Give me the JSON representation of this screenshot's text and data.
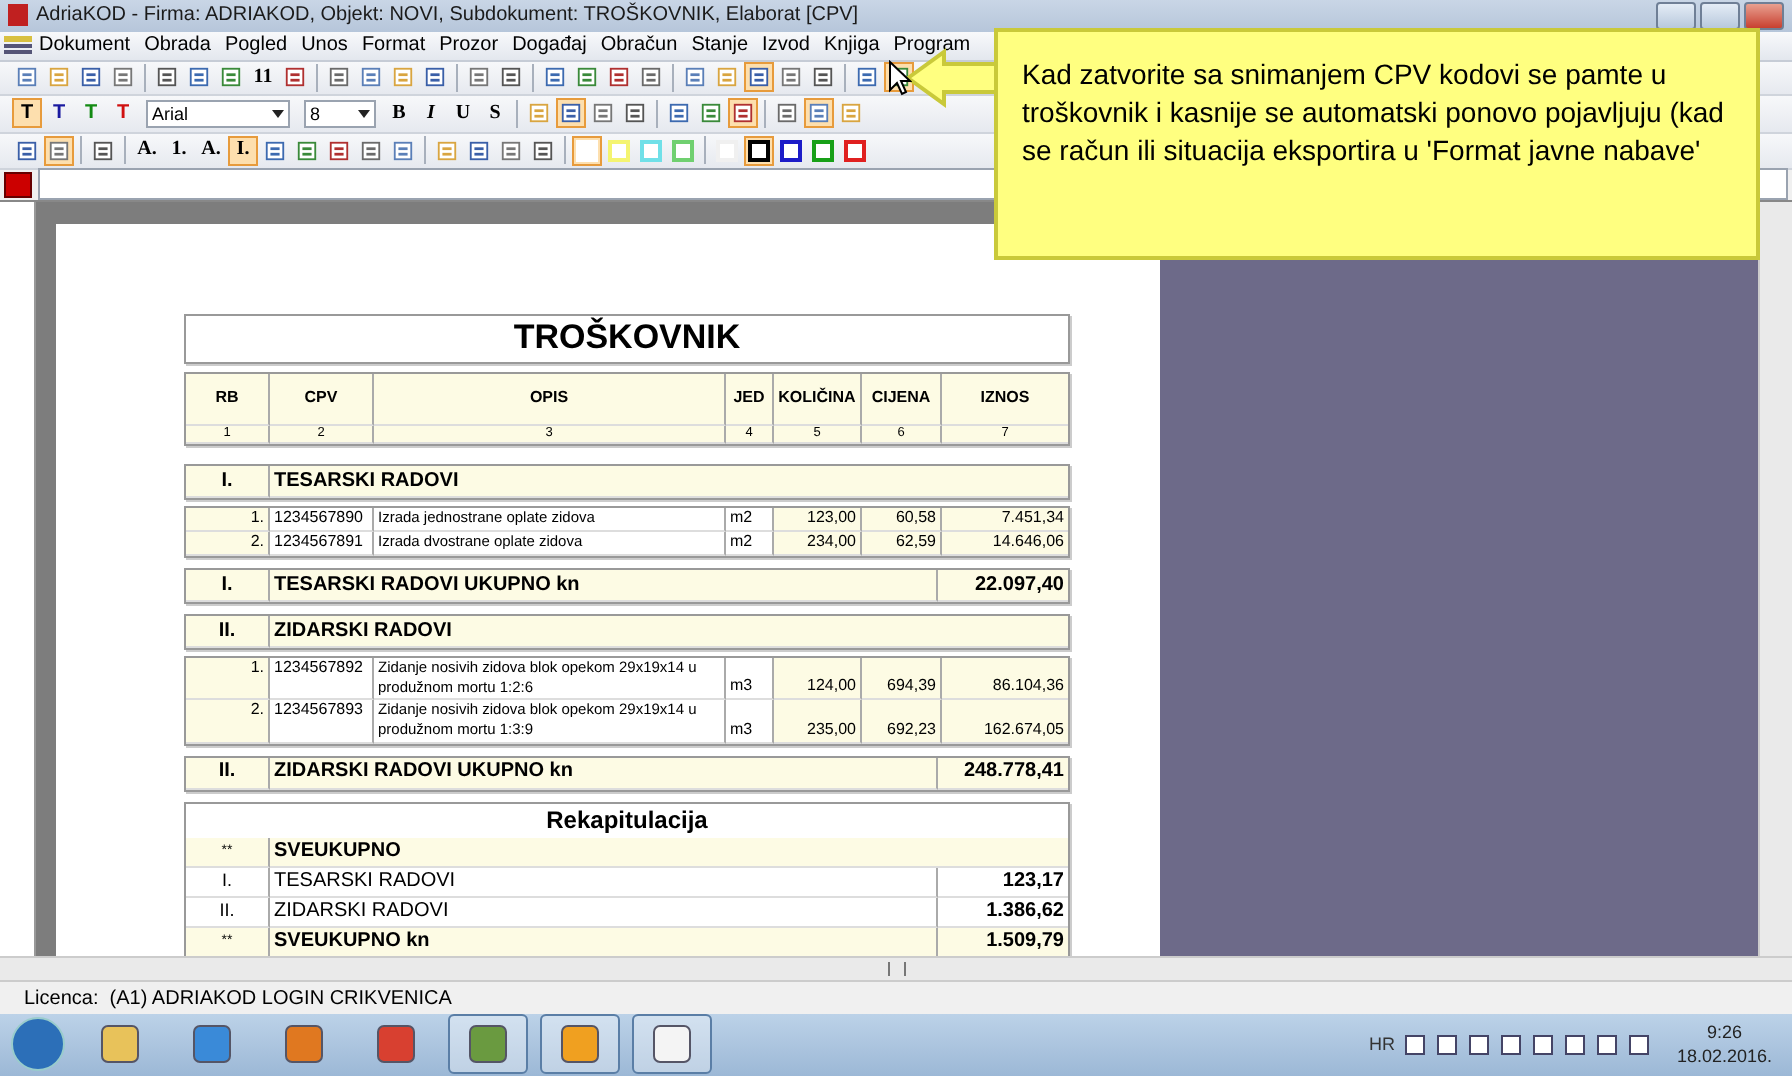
{
  "window": {
    "title": "AdriaKOD - Firma: ADRIAKOD,  Objekt: NOVI,  Subdokument: TROŠKOVNIK,  Elaborat [CPV]"
  },
  "menu": [
    "Dokument",
    "Obrada",
    "Pogled",
    "Unos",
    "Format",
    "Prozor",
    "Događaj",
    "Obračun",
    "Stanje",
    "Izvod",
    "Knjiga",
    "Program"
  ],
  "toolbars": [
    {
      "items": [
        {
          "kind": "icon",
          "pressed": false
        },
        {
          "kind": "icon",
          "pressed": false
        },
        {
          "kind": "icon",
          "pressed": false
        },
        {
          "kind": "icon",
          "pressed": false
        },
        {
          "kind": "separator"
        },
        {
          "kind": "icon",
          "pressed": false
        },
        {
          "kind": "icon",
          "pressed": false
        },
        {
          "kind": "icon",
          "pressed": false
        },
        {
          "kind": "text",
          "label": "11",
          "pressed": false
        },
        {
          "kind": "icon",
          "pressed": false
        },
        {
          "kind": "separator"
        },
        {
          "kind": "icon",
          "pressed": false
        },
        {
          "kind": "icon",
          "pressed": false
        },
        {
          "kind": "icon",
          "pressed": false
        },
        {
          "kind": "icon",
          "pressed": false
        },
        {
          "kind": "separator"
        },
        {
          "kind": "icon",
          "pressed": false
        },
        {
          "kind": "icon",
          "pressed": false
        },
        {
          "kind": "separator"
        },
        {
          "kind": "icon",
          "pressed": false
        },
        {
          "kind": "icon",
          "pressed": false
        },
        {
          "kind": "icon",
          "pressed": false
        },
        {
          "kind": "icon",
          "pressed": false
        },
        {
          "kind": "separator"
        },
        {
          "kind": "icon",
          "pressed": false
        },
        {
          "kind": "icon",
          "pressed": false
        },
        {
          "kind": "icon",
          "pressed": true
        },
        {
          "kind": "icon",
          "pressed": false
        },
        {
          "kind": "icon",
          "pressed": false
        },
        {
          "kind": "separator"
        },
        {
          "kind": "icon",
          "pressed": false
        },
        {
          "kind": "icon",
          "pressed": true
        }
      ]
    },
    {
      "items": [
        {
          "kind": "text",
          "label": "T",
          "pressed": true,
          "color": "#000000"
        },
        {
          "kind": "text",
          "label": "T",
          "pressed": false,
          "color": "#1a1aa0"
        },
        {
          "kind": "text",
          "label": "T",
          "pressed": false,
          "color": "#138a13"
        },
        {
          "kind": "text",
          "label": "T",
          "pressed": false,
          "color": "#d01010"
        },
        {
          "kind": "combo",
          "value": "Arial"
        },
        {
          "kind": "combo",
          "value": "8"
        },
        {
          "kind": "text",
          "label": "B",
          "pressed": false
        },
        {
          "kind": "text",
          "label": "I",
          "pressed": false
        },
        {
          "kind": "text",
          "label": "U",
          "pressed": false
        },
        {
          "kind": "text",
          "label": "S",
          "pressed": false
        },
        {
          "kind": "separator"
        },
        {
          "kind": "icon",
          "pressed": false
        },
        {
          "kind": "icon",
          "pressed": true
        },
        {
          "kind": "icon",
          "pressed": false
        },
        {
          "kind": "icon",
          "pressed": false
        },
        {
          "kind": "separator"
        },
        {
          "kind": "icon",
          "pressed": false
        },
        {
          "kind": "icon",
          "pressed": false
        },
        {
          "kind": "icon",
          "pressed": true
        },
        {
          "kind": "separator"
        },
        {
          "kind": "icon",
          "pressed": false
        },
        {
          "kind": "icon",
          "pressed": true
        },
        {
          "kind": "icon",
          "pressed": false
        }
      ]
    },
    {
      "items": [
        {
          "kind": "icon",
          "pressed": false
        },
        {
          "kind": "icon",
          "pressed": true
        },
        {
          "kind": "separator"
        },
        {
          "kind": "icon",
          "pressed": false
        },
        {
          "kind": "separator"
        },
        {
          "kind": "text",
          "label": "A.",
          "pressed": false
        },
        {
          "kind": "text",
          "label": "1.",
          "pressed": false
        },
        {
          "kind": "text",
          "label": "A.",
          "pressed": false
        },
        {
          "kind": "text",
          "label": "I.",
          "pressed": true
        },
        {
          "kind": "icon",
          "pressed": false
        },
        {
          "kind": "icon",
          "pressed": false
        },
        {
          "kind": "icon",
          "pressed": false
        },
        {
          "kind": "icon",
          "pressed": false
        },
        {
          "kind": "icon",
          "pressed": false
        },
        {
          "kind": "separator"
        },
        {
          "kind": "icon",
          "pressed": false
        },
        {
          "kind": "icon",
          "pressed": false
        },
        {
          "kind": "icon",
          "pressed": false
        },
        {
          "kind": "icon",
          "pressed": false
        },
        {
          "kind": "separator"
        },
        {
          "kind": "swatch",
          "color": "#ffffff",
          "pressed": true
        },
        {
          "kind": "swatch",
          "color": "#f4f470",
          "pressed": false
        },
        {
          "kind": "swatch",
          "color": "#70e0e8",
          "pressed": false
        },
        {
          "kind": "swatch",
          "color": "#70d070",
          "pressed": false
        },
        {
          "kind": "separator"
        },
        {
          "kind": "swatch",
          "color": "#f0f0f0",
          "pressed": false
        },
        {
          "kind": "swatch",
          "color": "#000000",
          "pressed": true
        },
        {
          "kind": "swatch",
          "color": "#1c1cc8",
          "pressed": false
        },
        {
          "kind": "swatch",
          "color": "#18a018",
          "pressed": false
        },
        {
          "kind": "swatch",
          "color": "#e02020",
          "pressed": false
        }
      ]
    }
  ],
  "style_swatch": {
    "color": "#cc0000"
  },
  "document": {
    "title": "TROŠKOVNIK",
    "columns": [
      {
        "label": "RB",
        "number": "1"
      },
      {
        "label": "CPV",
        "number": "2"
      },
      {
        "label": "OPIS",
        "number": "3"
      },
      {
        "label": "JED",
        "number": "4"
      },
      {
        "label": "KOLIČINA",
        "number": "5"
      },
      {
        "label": "CIJENA",
        "number": "6"
      },
      {
        "label": "IZNOS",
        "number": "7"
      }
    ],
    "sections": [
      {
        "number": "I.",
        "title": "TESARSKI RADOVI",
        "items": [
          {
            "rb": "1.",
            "cpv": "1234567890",
            "opis": "Izrada jednostrane oplate zidova",
            "jed": "m2",
            "kolicina": "123,00",
            "cijena": "60,58",
            "iznos": "7.451,34"
          },
          {
            "rb": "2.",
            "cpv": "1234567891",
            "opis": "Izrada dvostrane oplate zidova",
            "jed": "m2",
            "kolicina": "234,00",
            "cijena": "62,59",
            "iznos": "14.646,06"
          }
        ],
        "total_number": "I.",
        "total_label": "TESARSKI RADOVI UKUPNO kn",
        "total": "22.097,40"
      },
      {
        "number": "II.",
        "title": "ZIDARSKI RADOVI",
        "items": [
          {
            "rb": "1.",
            "cpv": "1234567892",
            "opis": "Zidanje nosivih zidova blok opekom 29x19x14 u produžnom mortu 1:2:6",
            "jed": "m3",
            "kolicina": "124,00",
            "cijena": "694,39",
            "iznos": "86.104,36"
          },
          {
            "rb": "2.",
            "cpv": "1234567893",
            "opis": "Zidanje nosivih zidova blok opekom 29x19x14 u produžnom mortu 1:3:9",
            "jed": "m3",
            "kolicina": "235,00",
            "cijena": "692,23",
            "iznos": "162.674,05"
          }
        ],
        "total_number": "II.",
        "total_label": "ZIDARSKI RADOVI UKUPNO kn",
        "total": "248.778,41"
      }
    ],
    "recap": {
      "title": "Rekapitulacija",
      "rows": [
        {
          "kind": "heading",
          "number": "**",
          "label": "SVEUKUPNO"
        },
        {
          "kind": "line",
          "number": "I.",
          "label": "TESARSKI RADOVI",
          "value": "123,17"
        },
        {
          "kind": "line",
          "number": "II.",
          "label": "ZIDARSKI RADOVI",
          "value": "1.386,62"
        },
        {
          "kind": "total",
          "number": "**",
          "label": "SVEUKUPNO kn",
          "value": "1.509,79"
        }
      ]
    }
  },
  "callout": {
    "text": "Kad zatvorite sa snimanjem CPV kodovi se pamte u troškovnik i kasnije se automatski ponovo pojavljuju (kad se račun ili situacija eksportira u 'Format javne nabave'"
  },
  "status_bar": {
    "license": "Licenca:  (A1) ADRIAKOD LOGIN CRIKVENICA"
  },
  "taskbar": {
    "apps": [
      {
        "pressed": false
      },
      {
        "pressed": false
      },
      {
        "pressed": false
      },
      {
        "pressed": false
      },
      {
        "pressed": true
      },
      {
        "pressed": true
      },
      {
        "pressed": true
      }
    ],
    "language": "HR",
    "time": "9:26",
    "date": "18.02.2016."
  }
}
